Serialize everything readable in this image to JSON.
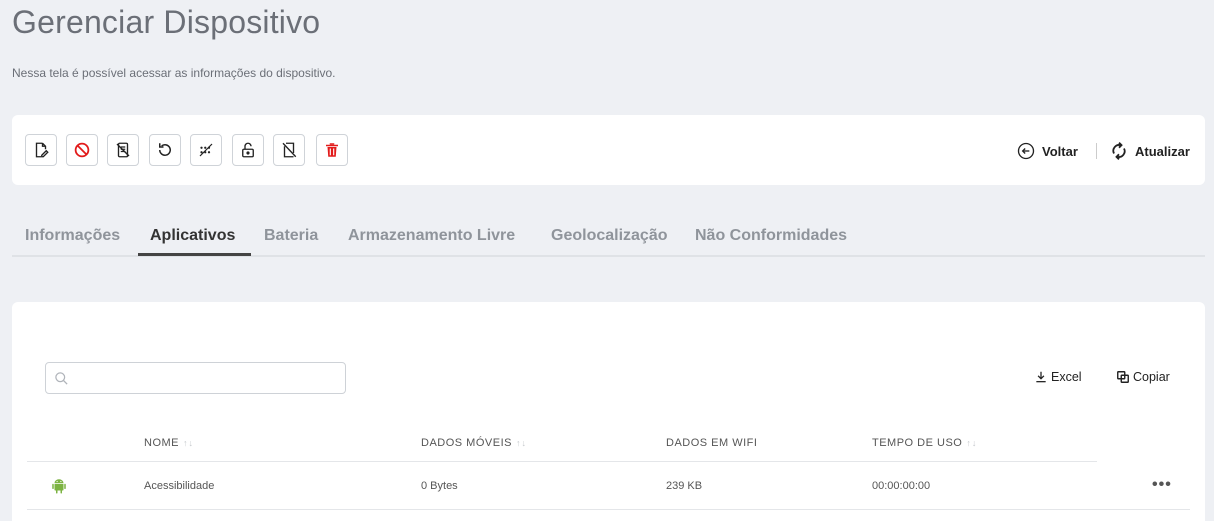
{
  "page": {
    "title": "Gerenciar Dispositivo",
    "subtitle": "Nessa tela é possível acessar as informações do dispositivo."
  },
  "toolbar": {
    "buttons": [
      {
        "name": "edit-device-icon"
      },
      {
        "name": "block-icon"
      },
      {
        "name": "device-disable-icon"
      },
      {
        "name": "reboot-icon"
      },
      {
        "name": "clear-password-icon"
      },
      {
        "name": "unlock-icon"
      },
      {
        "name": "device-off-icon"
      },
      {
        "name": "delete-icon",
        "color": "#e21b1b"
      }
    ],
    "back_label": "Voltar",
    "refresh_label": "Atualizar"
  },
  "tabs": [
    {
      "label": "Informações",
      "active": false
    },
    {
      "label": "Aplicativos",
      "active": true
    },
    {
      "label": "Bateria",
      "active": false
    },
    {
      "label": "Armazenamento Livre",
      "active": false
    },
    {
      "label": "Geolocalização",
      "active": false
    },
    {
      "label": "Não Conformidades",
      "active": false
    }
  ],
  "apps": {
    "search": {
      "placeholder": "",
      "value": ""
    },
    "excel_label": "Excel",
    "copy_label": "Copiar",
    "columns": [
      {
        "label": "NOME",
        "sortable": true
      },
      {
        "label": "DADOS MÓVEIS",
        "sortable": true
      },
      {
        "label": "DADOS EM WIFI",
        "sortable": false
      },
      {
        "label": "TEMPO DE USO",
        "sortable": true
      }
    ],
    "rows": [
      {
        "icon": "android-icon",
        "name": "Acessibilidade",
        "mobile_data": "0 Bytes",
        "wifi_data": "239 KB",
        "usage_time": "00:00:00:00",
        "menu": "•••"
      }
    ]
  },
  "colors": {
    "background": "#eef0f4",
    "danger": "#e21b1b",
    "android": "#7cb342"
  }
}
